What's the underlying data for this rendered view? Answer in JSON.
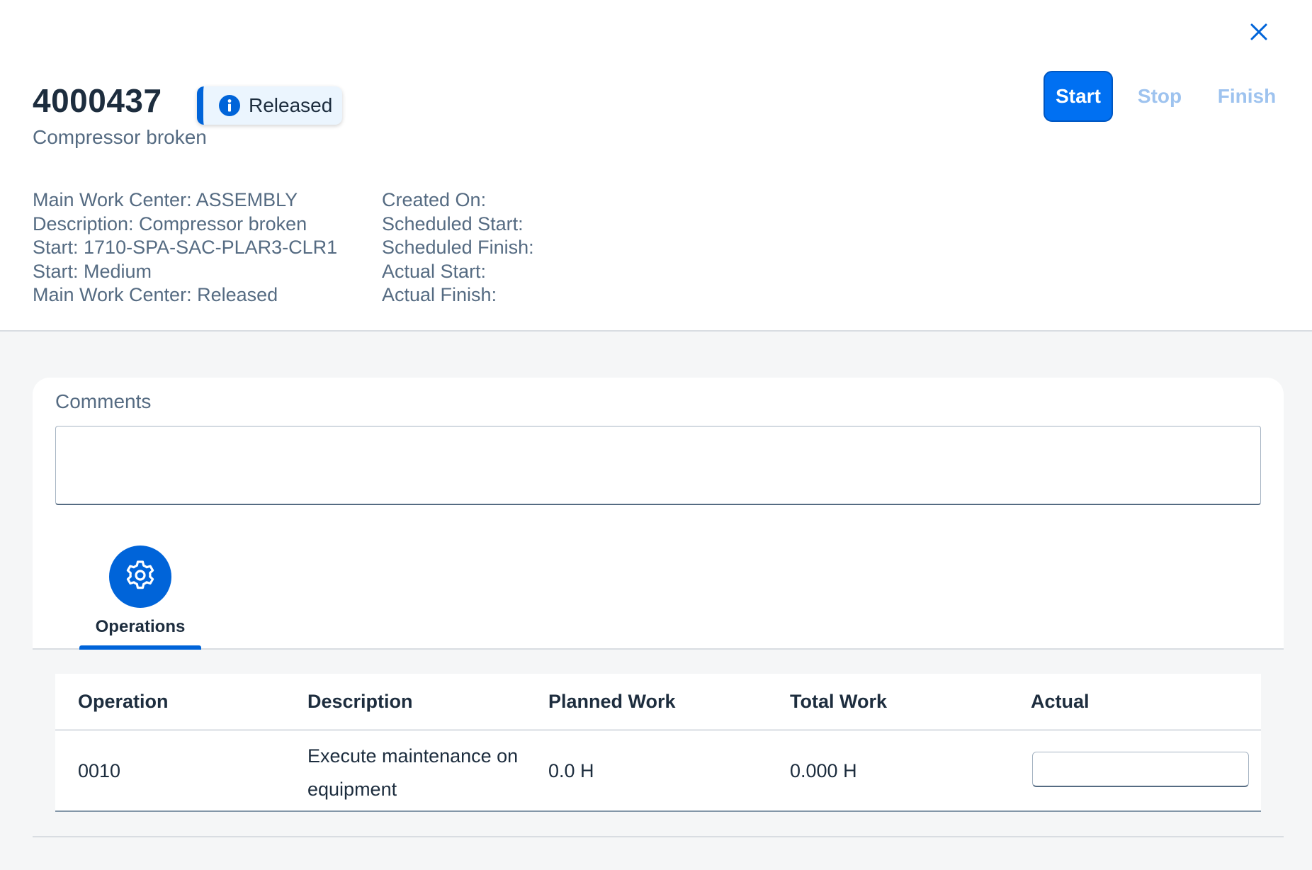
{
  "header": {
    "order_id": "4000437",
    "status": "Released",
    "subtitle": "Compressor broken",
    "actions": {
      "start": "Start",
      "stop": "Stop",
      "finish": "Finish"
    },
    "details_left": [
      "Main Work Center: ASSEMBLY",
      "Description: Compressor broken",
      "Start: 1710-SPA-SAC-PLAR3-CLR1",
      "Start: Medium",
      "Main Work Center: Released"
    ],
    "details_right": [
      "Created On:",
      "Scheduled Start:",
      "Scheduled Finish:",
      "Actual Start:",
      "Actual Finish:"
    ]
  },
  "comments": {
    "label": "Comments",
    "value": ""
  },
  "tabs": [
    {
      "label": "Operations",
      "icon": "gear-icon",
      "selected": true
    }
  ],
  "table": {
    "columns": [
      "Operation",
      "Description",
      "Planned Work",
      "Total Work",
      "Actual"
    ],
    "rows": [
      {
        "operation": "0010",
        "description": "Execute maintenance on equipment",
        "planned_work": "0.0 H",
        "total_work": "0.000 H",
        "actual": ""
      }
    ]
  },
  "colors": {
    "accent": "#0070f2",
    "badge_border": "#0064d9",
    "disabled_action": "#9ec3ef"
  }
}
